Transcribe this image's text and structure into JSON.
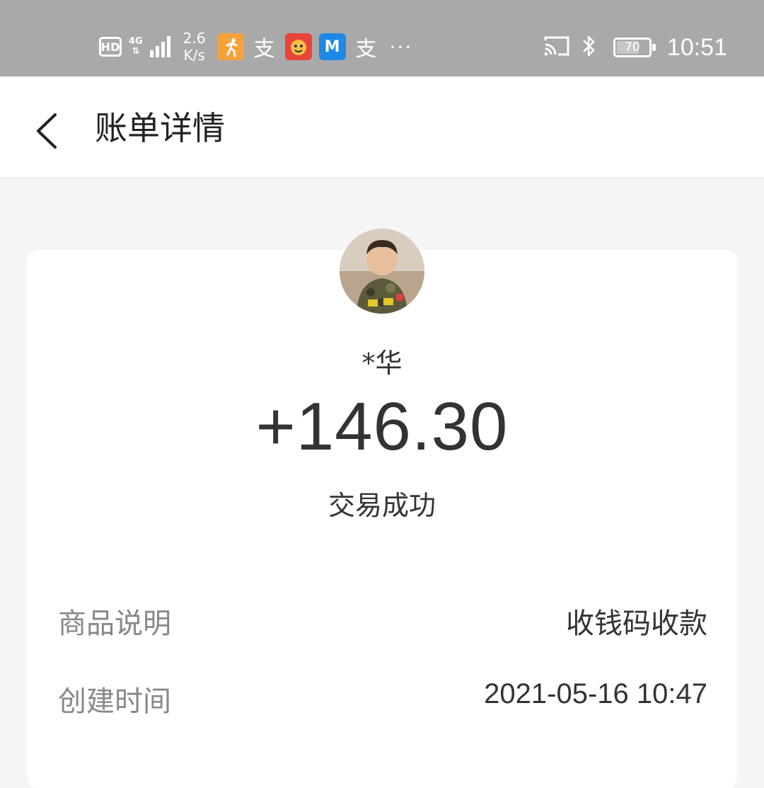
{
  "status_bar": {
    "hd": "HD",
    "network": "4G",
    "speed_value": "2.6",
    "speed_unit": "K/s",
    "alipay_glyph_1": "支",
    "app_m": "M",
    "alipay_glyph_2": "支",
    "more": "···",
    "battery": "70",
    "battery_level": 0.7,
    "time": "10:51"
  },
  "header": {
    "title": "账单详情"
  },
  "transaction": {
    "payer": "*华",
    "amount": "+146.30",
    "status": "交易成功"
  },
  "details": [
    {
      "label": "商品说明",
      "value": "收钱码收款"
    },
    {
      "label": "创建时间",
      "value": "2021-05-16 10:47"
    }
  ],
  "colors": {
    "status_bar_bg": "#a9a9a9",
    "page_bg": "#f5f5f5",
    "card_bg": "#ffffff",
    "label_gray": "#888888",
    "text_dark": "#333333"
  }
}
